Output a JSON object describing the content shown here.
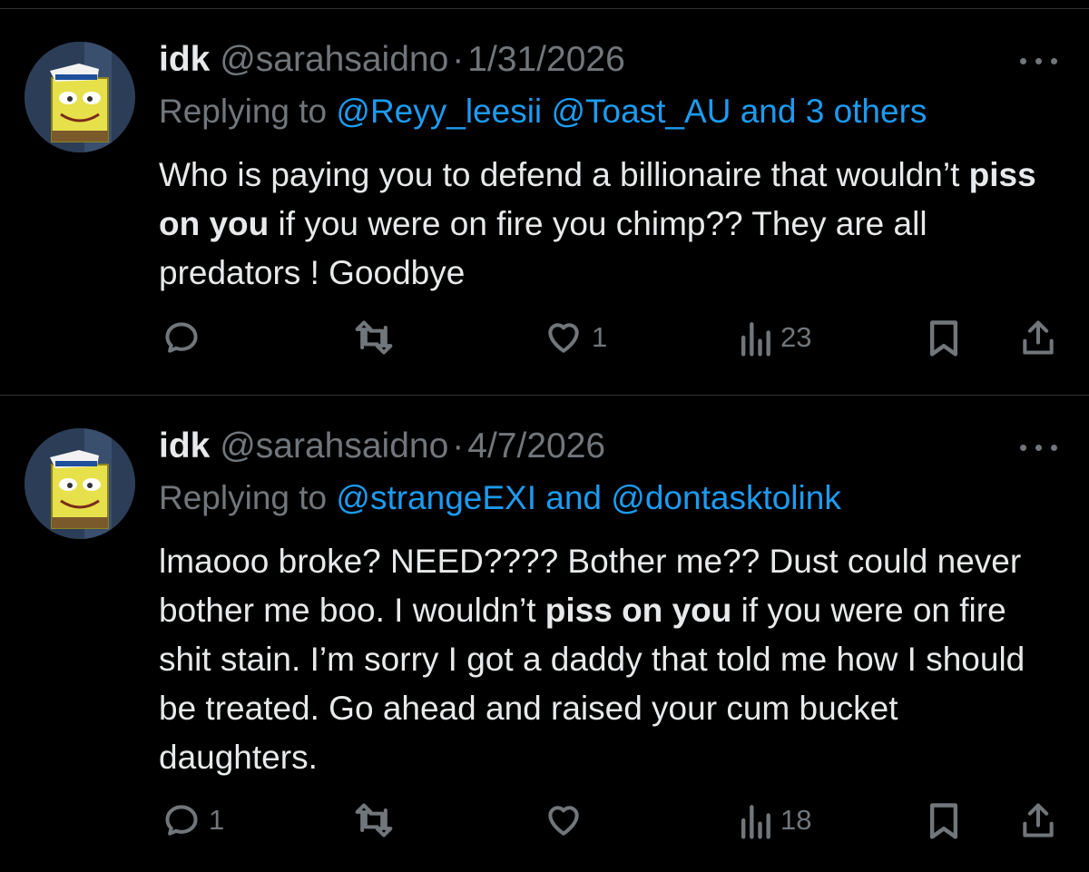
{
  "tweets": [
    {
      "display_name": "idk",
      "handle": "@sarahsaidno",
      "dot": "·",
      "date": "1/31/2026",
      "replying_prefix": "Replying to",
      "mentions": [
        "@Reyy_leesii",
        "@Toast_AU"
      ],
      "mention_suffix": "and 3 others",
      "body": [
        {
          "text": "Who is paying you to defend a billionaire that wouldn’t ",
          "bold": false
        },
        {
          "text": "piss on you",
          "bold": true
        },
        {
          "text": " if you were on fire you chimp?? They are all predators ! Goodbye",
          "bold": false
        }
      ],
      "reply_count": "",
      "retweet_count": "",
      "like_count": "1",
      "view_count": "23"
    },
    {
      "display_name": "idk",
      "handle": "@sarahsaidno",
      "dot": "·",
      "date": "4/7/2026",
      "replying_prefix": "Replying to",
      "mentions": [
        "@strangeEXI",
        "@dontasktolink"
      ],
      "mention_joiner": "and",
      "body": [
        {
          "text": "lmaooo broke? NEED???? Bother me?? Dust could never bother me boo. I wouldn’t ",
          "bold": false
        },
        {
          "text": "piss on you",
          "bold": true
        },
        {
          "text": " if you were on fire shit stain. I’m sorry I got a daddy that told me how I should be treated. Go ahead and raised your cum bucket daughters.",
          "bold": false
        }
      ],
      "reply_count": "1",
      "retweet_count": "",
      "like_count": "",
      "view_count": "18"
    }
  ],
  "icons": {
    "more": "more-horizontal-icon",
    "reply": "reply-icon",
    "retweet": "retweet-icon",
    "like": "heart-icon",
    "views": "views-icon",
    "bookmark": "bookmark-icon",
    "share": "share-icon"
  },
  "colors": {
    "background": "#000000",
    "text": "#e7e9ea",
    "muted": "#71767b",
    "link": "#1d9bf0",
    "divider": "#2f3336"
  }
}
